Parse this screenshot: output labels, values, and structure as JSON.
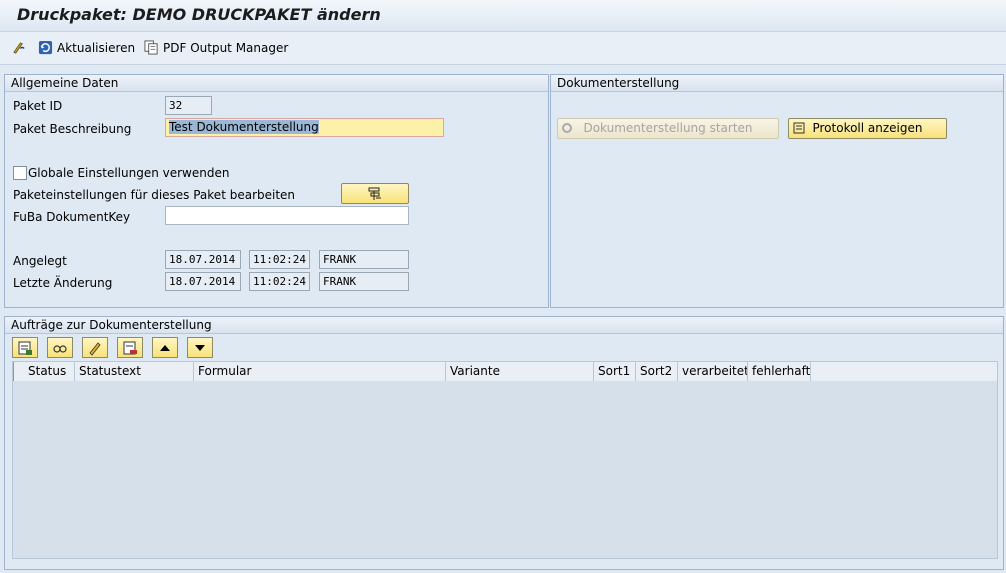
{
  "window": {
    "title": "Druckpaket: DEMO DRUCKPAKET ändern"
  },
  "toolbar": {
    "refresh_label": "Aktualisieren",
    "pdf_label": "PDF Output Manager"
  },
  "general": {
    "heading": "Allgemeine Daten",
    "paket_id_label": "Paket ID",
    "paket_id": "32",
    "beschreibung_label": "Paket Beschreibung",
    "beschreibung": "Test Dokumenterstellung",
    "globale_label": "Globale Einstellungen verwenden",
    "paketeinst_label": "Paketeinstellungen für dieses Paket bearbeiten",
    "fuba_label": "FuBa DokumentKey",
    "fuba_value": "",
    "angelegt_label": "Angelegt",
    "angelegt_date": "18.07.2014",
    "angelegt_time": "11:02:24",
    "angelegt_user": "FRANK",
    "aenderung_label": "Letzte Änderung",
    "aenderung_date": "18.07.2014",
    "aenderung_time": "11:02:24",
    "aenderung_user": "FRANK"
  },
  "doc": {
    "heading": "Dokumenterstellung",
    "start_label": "Dokumenterstellung starten",
    "protokoll_label": "Protokoll anzeigen"
  },
  "orders": {
    "heading": "Aufträge zur Dokumenterstellung",
    "columns": [
      "Status",
      "Statustext",
      "Formular",
      "Variante",
      "Sort1",
      "Sort2",
      "verarbeitet",
      "fehlerhaft"
    ]
  }
}
